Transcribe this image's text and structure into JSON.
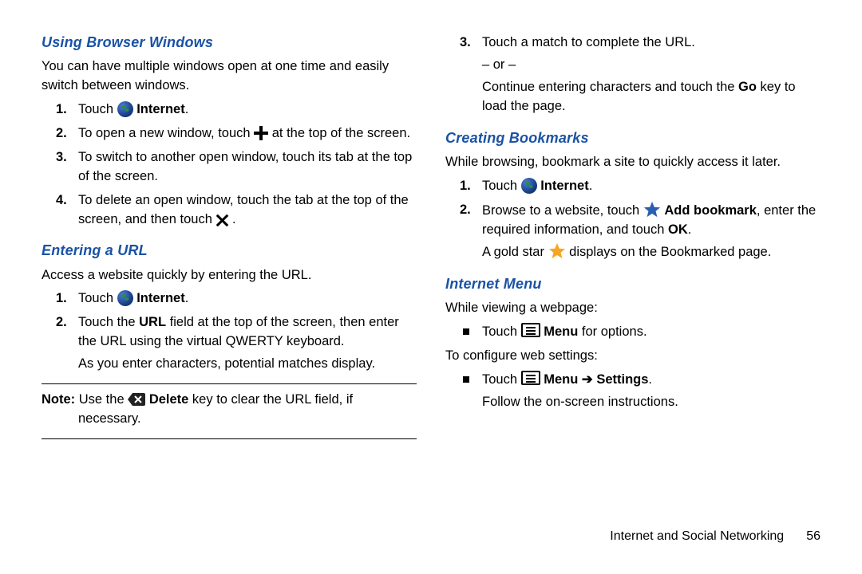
{
  "left": {
    "h1": "Using Browser Windows",
    "p1": "You can have multiple windows open at one time and easily switch between windows.",
    "li1_a": "Touch ",
    "li1_b": "Internet",
    "li1_c": ".",
    "li2_a": "To open a new window, touch ",
    "li2_b": " at the top of the screen.",
    "li3": "To switch to another open window, touch its tab at the top of the screen.",
    "li4_a": "To delete an open window, touch the tab at the top of the screen, and then touch ",
    "li4_b": " .",
    "h2": "Entering a URL",
    "p2": "Access a website quickly by entering the URL.",
    "li5_a": "Touch ",
    "li5_b": "Internet",
    "li5_c": ".",
    "li6_a": "Touch the ",
    "li6_b": "URL",
    "li6_c": " field at the top of the screen, then enter the URL using the virtual QWERTY keyboard.",
    "li6_sub": "As you enter characters, potential matches display.",
    "note_a": "Note:",
    "note_b": " Use the ",
    "note_c": "Delete",
    "note_d": " key to clear the URL field, if necessary."
  },
  "right": {
    "li1": "Touch a match to complete the URL.",
    "li1_or": "– or –",
    "li1_b_a": "Continue entering characters and touch the ",
    "li1_b_b": "Go",
    "li1_b_c": " key to load the page.",
    "h1": "Creating Bookmarks",
    "p1": "While browsing, bookmark a site to quickly access it later.",
    "li2_a": "Touch ",
    "li2_b": "Internet",
    "li2_c": ".",
    "li3_a": "Browse to a website, touch ",
    "li3_b": "Add bookmark",
    "li3_c": ", enter the required information, and touch ",
    "li3_d": "OK",
    "li3_e": ".",
    "li3_sub_a": "A gold star ",
    "li3_sub_b": " displays on the Bookmarked page.",
    "h2": "Internet Menu",
    "p2": "While viewing a webpage:",
    "b1_a": "Touch ",
    "b1_b": "Menu",
    "b1_c": " for options.",
    "p3": "To configure web settings:",
    "b2_a": "Touch ",
    "b2_b": "Menu",
    "b2_arrow": " ➔ ",
    "b2_c": "Settings",
    "b2_d": ".",
    "b2_sub": "Follow the on-screen instructions."
  },
  "footer": {
    "section": "Internet and Social Networking",
    "page": "56"
  }
}
